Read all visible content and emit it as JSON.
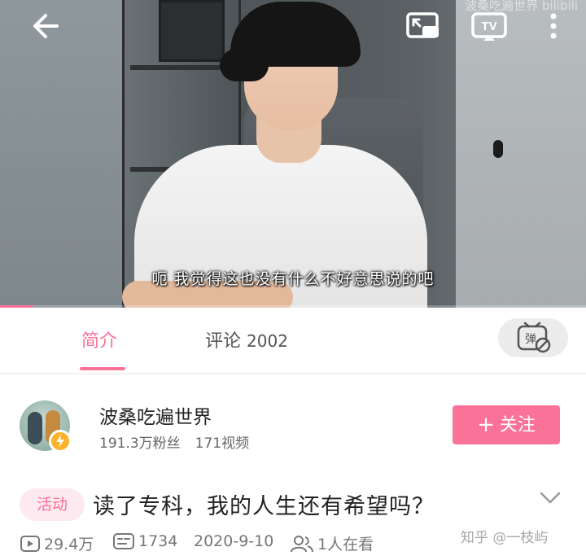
{
  "player": {
    "subtitle": "呃 我觉得这也没有什么不好意思说的吧",
    "watermark": "波桑吃遍世界  bilibili",
    "progress_fraction": 0.055,
    "tv_label": "TV"
  },
  "tabs": {
    "intro_label": "简介",
    "comments_label": "评论",
    "comments_count": "2002",
    "danmaku_icon_text": "弹"
  },
  "uploader": {
    "name": "波桑吃遍世界",
    "followers": "191.3万粉丝",
    "videos": "171视频",
    "follow_label": "关注",
    "follow_plus": "+"
  },
  "video": {
    "badge": "活动",
    "title": "读了专科，我的人生还有希望吗？",
    "views": "29.4万",
    "danmaku_count": "1734",
    "date": "2020-9-10",
    "watching": "1人在看"
  },
  "overlay": {
    "watermark": "知乎 @一枝屿"
  },
  "colors": {
    "accent": "#fb7299",
    "badge_bg": "#fdeaf0",
    "verified": "#fdb22b"
  },
  "icons": {
    "back": "back-arrow-icon",
    "pip": "picture-in-picture-icon",
    "tv": "tv-cast-icon",
    "more": "more-vertical-icon",
    "danmaku": "danmaku-toggle-icon",
    "expand": "chevron-down-icon",
    "views": "play-count-icon",
    "danmaku_count": "danmaku-count-icon",
    "watching": "people-icon"
  }
}
